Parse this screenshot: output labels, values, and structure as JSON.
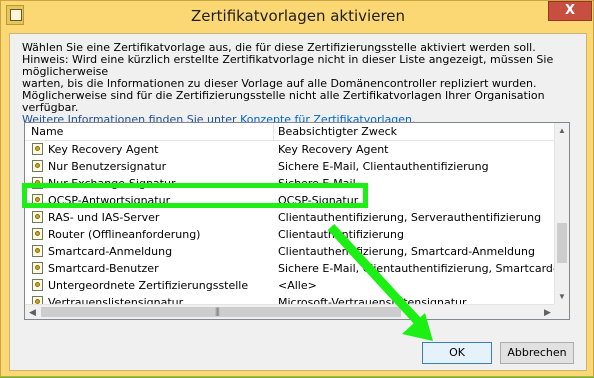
{
  "window": {
    "title": "Zertifikatvorlagen aktivieren",
    "close_label": "X"
  },
  "description": {
    "line1": "Wählen Sie eine Zertifikatvorlage aus, die für diese Zertifizierungsstelle aktiviert werden soll.",
    "line2": "Hinweis: Wird eine kürzlich erstellte Zertifikatvorlage nicht in dieser Liste angezeigt, müssen Sie möglicherweise",
    "line3": "warten, bis die Informationen zu dieser Vorlage auf alle Domänencontroller repliziert wurden.",
    "line4": "Möglicherweise sind für die Zertifizierungsstelle nicht alle Zertifikatvorlagen Ihrer Organisation verfügbar.",
    "more_info_prefix": "Weitere Informationen finden Sie unter ",
    "more_info_link": "Konzepte für Zertifikatvorlagen",
    "more_info_suffix": "."
  },
  "list": {
    "columns": [
      "Name",
      "Beabsichtigter Zweck"
    ],
    "rows": [
      {
        "name": "Key Recovery Agent",
        "purpose": "Key Recovery Agent"
      },
      {
        "name": "Nur Benutzersignatur",
        "purpose": "Sichere E-Mail, Clientauthentifizierung"
      },
      {
        "name": "Nur Exchange-Signatur",
        "purpose": "Sichere E-Mail"
      },
      {
        "name": "OCSP-Antwortsignatur",
        "purpose": "OCSP-Signatur"
      },
      {
        "name": "RAS- und IAS-Server",
        "purpose": "Clientauthentifizierung, Serverauthentifizierung"
      },
      {
        "name": "Router (Offlineanforderung)",
        "purpose": "Clientauthentifizierung"
      },
      {
        "name": "Smartcard-Anmeldung",
        "purpose": "Clientauthentifizierung, Smartcard-Anmeldung"
      },
      {
        "name": "Smartcard-Benutzer",
        "purpose": "Sichere E-Mail, Clientauthentifizierung, Smartcard-Anmeldung"
      },
      {
        "name": "Untergeordnete Zertifizierungsstelle",
        "purpose": "<Alle>"
      },
      {
        "name": "Vertrauenslistensignatur",
        "purpose": "Microsoft-Vertrauenslistensignatur"
      }
    ],
    "highlighted_row": "OCSP-Antwortsignatur",
    "scroll_grip": "|||"
  },
  "buttons": {
    "ok": "OK",
    "cancel": "Abbrechen"
  },
  "colors": {
    "highlight": "#1bef13",
    "title_bar": "#fbd873",
    "close_button": "#c74f40"
  },
  "icons": {
    "row_icon": "certificate-template-icon",
    "window_icon": "system-menu-icon"
  }
}
